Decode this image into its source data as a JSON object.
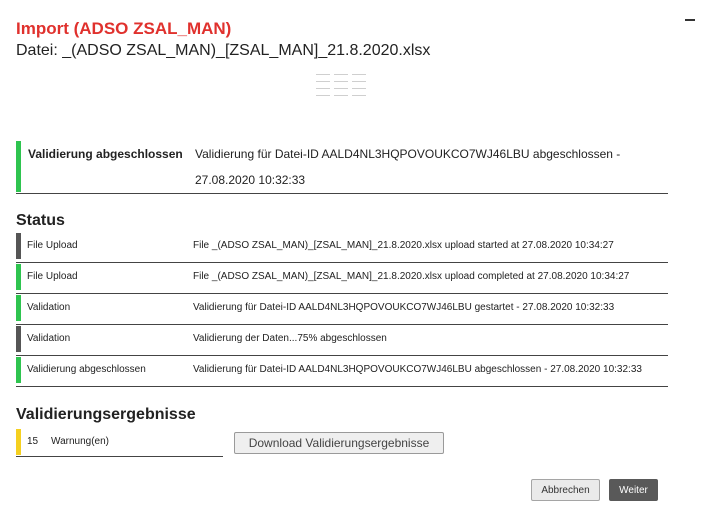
{
  "header": {
    "title": "Import  (ADSO ZSAL_MAN)",
    "subtitle": "Datei: _(ADSO ZSAL_MAN)_[ZSAL_MAN]_21.8.2020.xlsx"
  },
  "summary": {
    "label": "Validierung abgeschlossen",
    "message": "Validierung für Datei-ID AALD4NL3HQPOVOUKCO7WJ46LBU abgeschlossen - 27.08.2020 10:32:33",
    "status_color": "#2ec44f"
  },
  "status": {
    "title": "Status",
    "rows": [
      {
        "label": "File Upload",
        "message": "File _(ADSO ZSAL_MAN)_[ZSAL_MAN]_21.8.2020.xlsx upload started at 27.08.2020 10:34:27",
        "state": "gray"
      },
      {
        "label": "File Upload",
        "message": "File _(ADSO ZSAL_MAN)_[ZSAL_MAN]_21.8.2020.xlsx upload completed at 27.08.2020 10:34:27",
        "state": "green"
      },
      {
        "label": "Validation",
        "message": "Validierung für Datei-ID AALD4NL3HQPOVOUKCO7WJ46LBU gestartet - 27.08.2020 10:32:33",
        "state": "green"
      },
      {
        "label": "Validation",
        "message": "Validierung der Daten...75% abgeschlossen",
        "state": "gray"
      },
      {
        "label": "Validierung abgeschlossen",
        "message": "Validierung für Datei-ID AALD4NL3HQPOVOUKCO7WJ46LBU abgeschlossen - 27.08.2020 10:32:33",
        "state": "green"
      }
    ]
  },
  "results": {
    "title": "Validierungsergebnisse",
    "count": "15",
    "warning_label": "Warnung(en)",
    "download_label": "Download Validierungsergebnisse",
    "warning_color": "#f5d020"
  },
  "footer": {
    "cancel_label": "Abbrechen",
    "next_label": "Weiter"
  },
  "icons": {
    "minimize": "minimize-icon",
    "grid": "grid-icon"
  }
}
